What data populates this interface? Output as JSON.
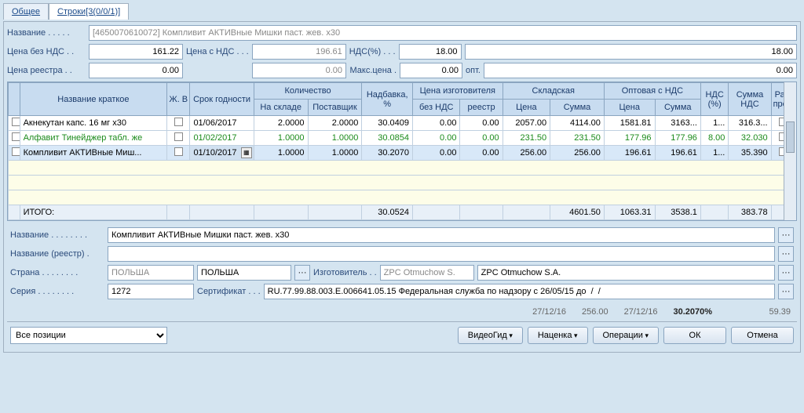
{
  "tabs": {
    "general": "Общее",
    "lines": "Строки[3(0/0/1)]"
  },
  "form": {
    "name_label": "Название . . . . .",
    "name_value": "[4650070610072] Компливит АКТИВные Мишки паст. жев. x30",
    "price_no_vat_label": "Цена без НДС . .",
    "price_no_vat": "161.22",
    "price_vat_label": "Цена с НДС . . .",
    "price_vat": "196.61",
    "vat_pct_label": "НДС(%) . . .",
    "vat_pct": "18.00",
    "vat_right": "18.00",
    "registry_price_label": "Цена реестра . .",
    "registry_price": "0.00",
    "blank_zero": "0.00",
    "max_price_label": "Макс.цена .",
    "max_price": "0.00",
    "opt_label": "опт.",
    "opt_value": "0.00"
  },
  "headers": {
    "short_name": "Название краткое",
    "jv": "Ж. В",
    "expiry": "Срок годности",
    "quantity": "Количество",
    "markup": "Надбавка, %",
    "mfr_price": "Цена изготовителя",
    "warehouse": "Складская",
    "wholesale_vat": "Оптовая с НДС",
    "vat_pct": "НДС (%)",
    "vat_sum": "Сумма НДС",
    "distr": "Рас-пред.",
    "in_stock": "На складе",
    "supplier": "Поставщик",
    "no_vat": "без НДС",
    "registry": "реестр",
    "price": "Цена",
    "sum": "Сумма"
  },
  "rows": [
    {
      "name": "Акнекутан капс. 16 мг x30",
      "date": "01/06/2017",
      "stock": "2.0000",
      "supp": "2.0000",
      "markup": "30.0409",
      "novat": "0.00",
      "reg": "0.00",
      "wprice": "2057.00",
      "wsum": "4114.00",
      "oprice": "1581.81",
      "osum": "3163...",
      "vat": "1...",
      "vatsum": "316.3..."
    },
    {
      "name": "Алфавит Тинейджер табл. же",
      "date": "01/02/2017",
      "stock": "1.0000",
      "supp": "1.0000",
      "markup": "30.0854",
      "novat": "0.00",
      "reg": "0.00",
      "wprice": "231.50",
      "wsum": "231.50",
      "oprice": "177.96",
      "osum": "177.96",
      "vat": "8.00",
      "vatsum": "32.030",
      "green": true
    },
    {
      "name": "Компливит АКТИВные Миш...",
      "date": "01/10/2017",
      "stock": "1.0000",
      "supp": "1.0000",
      "markup": "30.2070",
      "novat": "0.00",
      "reg": "0.00",
      "wprice": "256.00",
      "wsum": "256.00",
      "oprice": "196.61",
      "osum": "196.61",
      "vat": "1...",
      "vatsum": "35.390",
      "selected": true
    }
  ],
  "totals": {
    "label": "ИТОГО:",
    "markup": "30.0524",
    "wsum": "4601.50",
    "oprice": "1063.31",
    "osum": "3538.1",
    "vatsum": "383.78"
  },
  "lower": {
    "name_label": "Название . . . . . . . .",
    "name_value": "Компливит АКТИВные Мишки паст. жев. x30",
    "registry_name_label": "Название (реестр) .",
    "registry_name_value": "",
    "country_label": "Страна . . . . . . . .",
    "country1": "ПОЛЬША",
    "country2": "ПОЛЬША",
    "mfr_label": "Изготовитель . .",
    "mfr1": "ZPC Otmuchow S.",
    "mfr2": "ZPC Otmuchow S.A.",
    "series_label": "Серия . . . . . . . .",
    "series": "1272",
    "cert_label": "Сертификат . . .",
    "cert": "RU.77.99.88.003.Е.006641.05.15 Федеральная служба по надзору с 26/05/15 до  /  /"
  },
  "footer": {
    "date1": "27/12/16",
    "val1": "256.00",
    "date2": "27/12/16",
    "pct": "30.2070%",
    "total": "59.39",
    "positions": "Все позиции",
    "video": "ВидеоГид",
    "markup_btn": "Наценка",
    "ops": "Операции",
    "ok": "ОК",
    "cancel": "Отмена"
  }
}
